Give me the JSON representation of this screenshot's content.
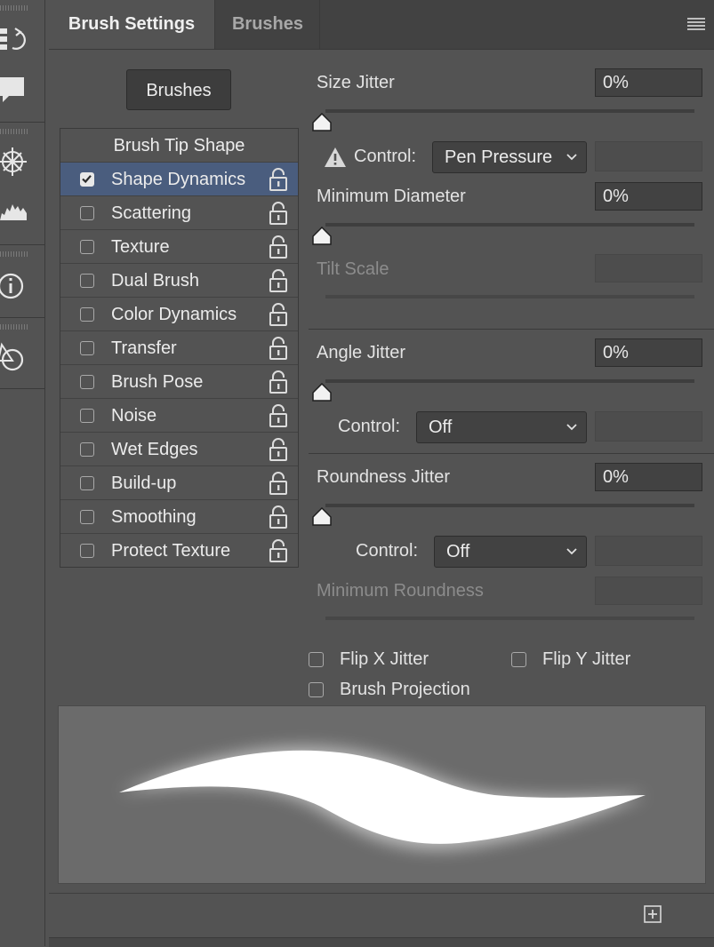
{
  "tabs": [
    {
      "label": "Brush Settings",
      "active": true
    },
    {
      "label": "Brushes",
      "active": false
    }
  ],
  "brushes_button": "Brushes",
  "brush_tip_shape": "Brush Tip Shape",
  "options": [
    {
      "label": "Shape Dynamics",
      "checked": true,
      "selected": true
    },
    {
      "label": "Scattering",
      "checked": false
    },
    {
      "label": "Texture",
      "checked": false
    },
    {
      "label": "Dual Brush",
      "checked": false
    },
    {
      "label": "Color Dynamics",
      "checked": false
    },
    {
      "label": "Transfer",
      "checked": false
    },
    {
      "label": "Brush Pose",
      "checked": false
    },
    {
      "label": "Noise",
      "checked": false
    },
    {
      "label": "Wet Edges",
      "checked": false
    },
    {
      "label": "Build-up",
      "checked": false
    },
    {
      "label": "Smoothing",
      "checked": false
    },
    {
      "label": "Protect Texture",
      "checked": false
    }
  ],
  "size_jitter": {
    "label": "Size Jitter",
    "value": "0%"
  },
  "size_control": {
    "label": "Control:",
    "value": "Pen Pressure"
  },
  "minimum_diameter": {
    "label": "Minimum Diameter",
    "value": "0%"
  },
  "tilt_scale": {
    "label": "Tilt Scale",
    "value": ""
  },
  "angle_jitter": {
    "label": "Angle Jitter",
    "value": "0%"
  },
  "angle_control": {
    "label": "Control:",
    "value": "Off"
  },
  "roundness_jitter": {
    "label": "Roundness Jitter",
    "value": "0%"
  },
  "roundness_control": {
    "label": "Control:",
    "value": "Off"
  },
  "minimum_roundness": {
    "label": "Minimum Roundness",
    "value": ""
  },
  "flip_x": {
    "label": "Flip X Jitter",
    "checked": false
  },
  "flip_y": {
    "label": "Flip Y Jitter",
    "checked": false
  },
  "brush_projection": {
    "label": "Brush Projection",
    "checked": false
  },
  "colors": {
    "panel": "#535353",
    "selected_row": "#4a5d7e",
    "field": "#424242",
    "preview": "#6b6b6b"
  },
  "icons": [
    "history-icon",
    "comment-icon",
    "navigator-icon",
    "histogram-icon",
    "info-icon",
    "shape-icon",
    "lock-icon",
    "warning-icon",
    "chevron-down-icon",
    "panel-menu-icon",
    "new-preset-icon"
  ]
}
